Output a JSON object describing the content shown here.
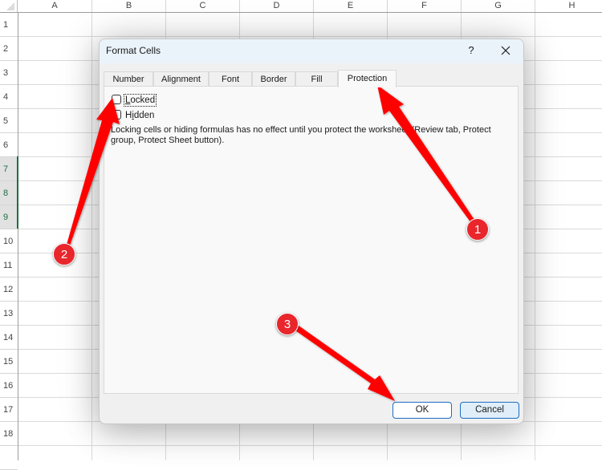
{
  "spreadsheet": {
    "columns": [
      "A",
      "B",
      "C",
      "D",
      "E",
      "F",
      "G",
      "H"
    ],
    "rows": [
      "1",
      "2",
      "3",
      "4",
      "5",
      "6",
      "7",
      "8",
      "9",
      "10",
      "11",
      "12",
      "13",
      "14",
      "15",
      "16",
      "17",
      "18"
    ],
    "selected_rows": [
      "7",
      "8",
      "9"
    ]
  },
  "dialog": {
    "title": "Format Cells",
    "help_label": "?",
    "close_label": "✕",
    "tabs": [
      {
        "label": "Number",
        "active": false
      },
      {
        "label": "Alignment",
        "active": false
      },
      {
        "label": "Font",
        "active": false
      },
      {
        "label": "Border",
        "active": false
      },
      {
        "label": "Fill",
        "active": false
      },
      {
        "label": "Protection",
        "active": true
      }
    ],
    "locked": {
      "label": "Locked",
      "checked": false
    },
    "hidden": {
      "label": "Hidden",
      "checked": false
    },
    "note": "Locking cells or hiding formulas has no effect until you protect the worksheet (Review tab, Protect group, Protect Sheet button).",
    "ok_label": "OK",
    "cancel_label": "Cancel"
  },
  "annotations": {
    "color": "#ff0000",
    "badges": [
      {
        "number": "1",
        "points_to": "Protection tab"
      },
      {
        "number": "2",
        "points_to": "Locked checkbox"
      },
      {
        "number": "3",
        "points_to": "OK button"
      }
    ]
  }
}
